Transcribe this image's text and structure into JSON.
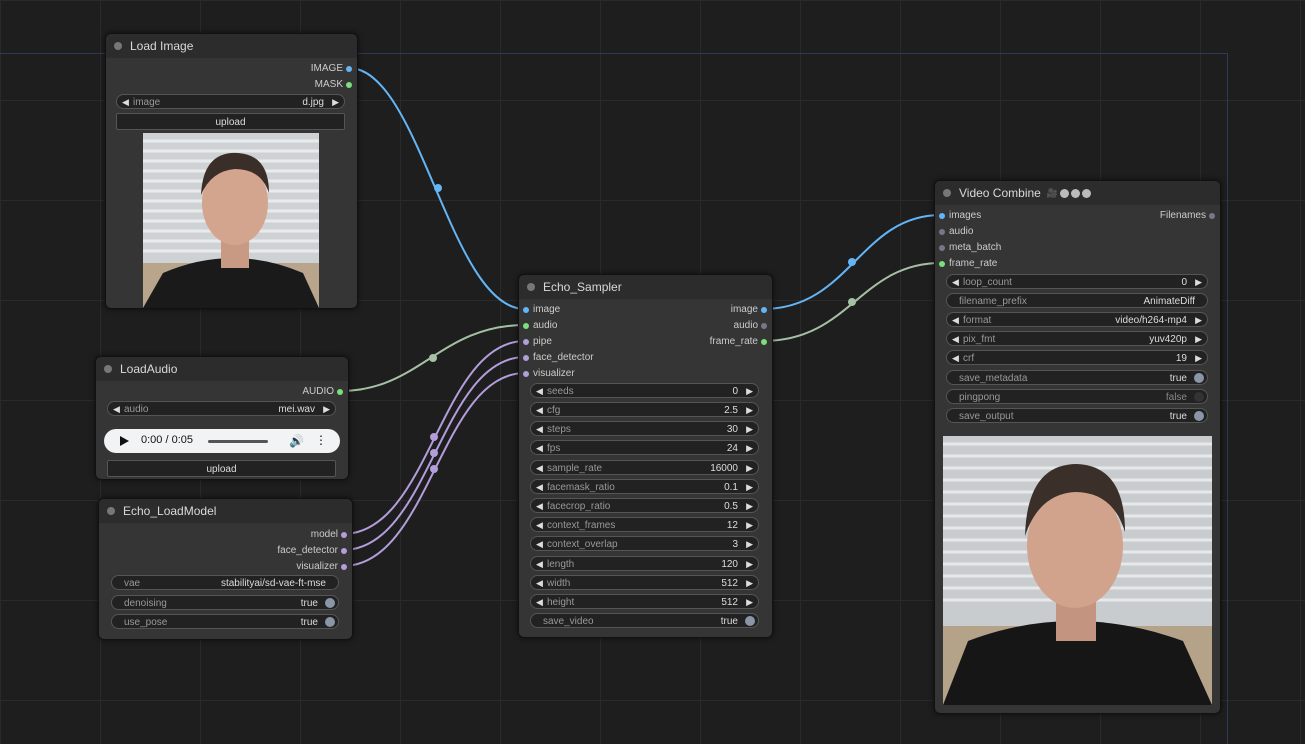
{
  "colors": {
    "image_link": "#64b5f6",
    "audio_link": "#a5c0a5",
    "model_link": "#b39ddb",
    "canvas_bg": "#1e1e1e",
    "node_bg": "#353535"
  },
  "load_image": {
    "title": "Load Image",
    "outputs": [
      "IMAGE",
      "MASK"
    ],
    "image_widget": {
      "label": "image",
      "value": "d.jpg"
    },
    "upload_label": "upload"
  },
  "load_audio": {
    "title": "LoadAudio",
    "output": "AUDIO",
    "audio_widget": {
      "label": "audio",
      "value": "mei.wav"
    },
    "player_time": "0:00 / 0:05",
    "upload_label": "upload"
  },
  "echo_loadmodel": {
    "title": "Echo_LoadModel",
    "outputs": [
      "model",
      "face_detector",
      "visualizer"
    ],
    "widgets": [
      {
        "label": "vae",
        "value": "stabilityai/sd-vae-ft-mse"
      },
      {
        "label": "denoising",
        "value": "true"
      },
      {
        "label": "use_pose",
        "value": "true"
      }
    ]
  },
  "echo_sampler": {
    "title": "Echo_Sampler",
    "inputs": [
      "image",
      "audio",
      "pipe",
      "face_detector",
      "visualizer"
    ],
    "outputs": [
      "image",
      "audio",
      "frame_rate"
    ],
    "widgets": [
      {
        "label": "seeds",
        "value": "0"
      },
      {
        "label": "cfg",
        "value": "2.5"
      },
      {
        "label": "steps",
        "value": "30"
      },
      {
        "label": "fps",
        "value": "24"
      },
      {
        "label": "sample_rate",
        "value": "16000"
      },
      {
        "label": "facemask_ratio",
        "value": "0.1"
      },
      {
        "label": "facecrop_ratio",
        "value": "0.5"
      },
      {
        "label": "context_frames",
        "value": "12"
      },
      {
        "label": "context_overlap",
        "value": "3"
      },
      {
        "label": "length",
        "value": "120"
      },
      {
        "label": "width",
        "value": "512"
      },
      {
        "label": "height",
        "value": "512"
      }
    ],
    "toggle": {
      "label": "save_video",
      "value": "true"
    }
  },
  "video_combine": {
    "title": "Video Combine",
    "badge_icons": [
      "vhs-icon",
      "circle-icon",
      "circle-icon",
      "circle-icon"
    ],
    "inputs": [
      "images",
      "audio",
      "meta_batch",
      "frame_rate"
    ],
    "output": "Filenames",
    "widgets": [
      {
        "label": "loop_count",
        "value": "0"
      },
      {
        "label": "filename_prefix",
        "value": "AnimateDiff"
      },
      {
        "label": "format",
        "value": "video/h264-mp4"
      },
      {
        "label": "pix_fmt",
        "value": "yuv420p"
      },
      {
        "label": "crf",
        "value": "19"
      },
      {
        "label": "save_metadata",
        "value": "true"
      },
      {
        "label": "pingpong",
        "value": "false"
      },
      {
        "label": "save_output",
        "value": "true"
      }
    ]
  }
}
